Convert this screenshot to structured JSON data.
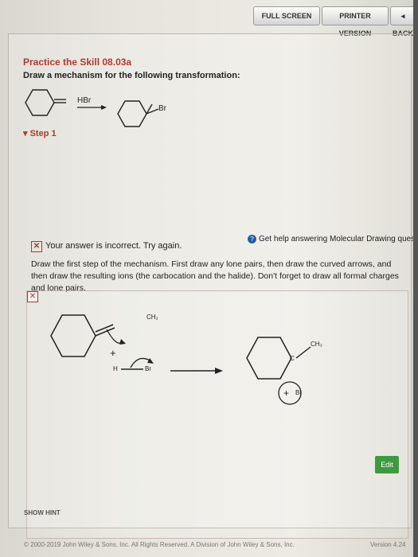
{
  "toolbar": {
    "full_screen": "FULL SCREEN",
    "printer_version": "PRINTER VERSION",
    "back": "◂ BACK"
  },
  "problem": {
    "title": "Practice the Skill 08.03a",
    "prompt": "Draw a mechanism for the following transformation:",
    "reagent": "HBr",
    "product_sub": "Br"
  },
  "step": {
    "label": "▾ Step 1",
    "incorrect_text": "Your answer is incorrect.  Try again.",
    "help_text": "Get help answering Molecular Drawing questions",
    "instructions": "Draw the first step of the mechanism. First draw any lone pairs, then draw the curved arrows, and then draw the resulting ions (the carbocation and the halide). Don't forget to draw all formal charges and lone pairs."
  },
  "drawing": {
    "ch2_label": "CH₂",
    "plus": "+",
    "hbr_h": "H",
    "hbr_br": "Br",
    "cation_c": "C",
    "ch3_label": "CH₃",
    "br_ion": "Br",
    "plus2": "+"
  },
  "edit_button": "Edit",
  "show_hint": "SHOW HINT",
  "footer": "© 2000-2019 John Wiley & Sons, Inc. All Rights Reserved. A Division of John Wiley & Sons, Inc.",
  "version": "Version 4.24"
}
